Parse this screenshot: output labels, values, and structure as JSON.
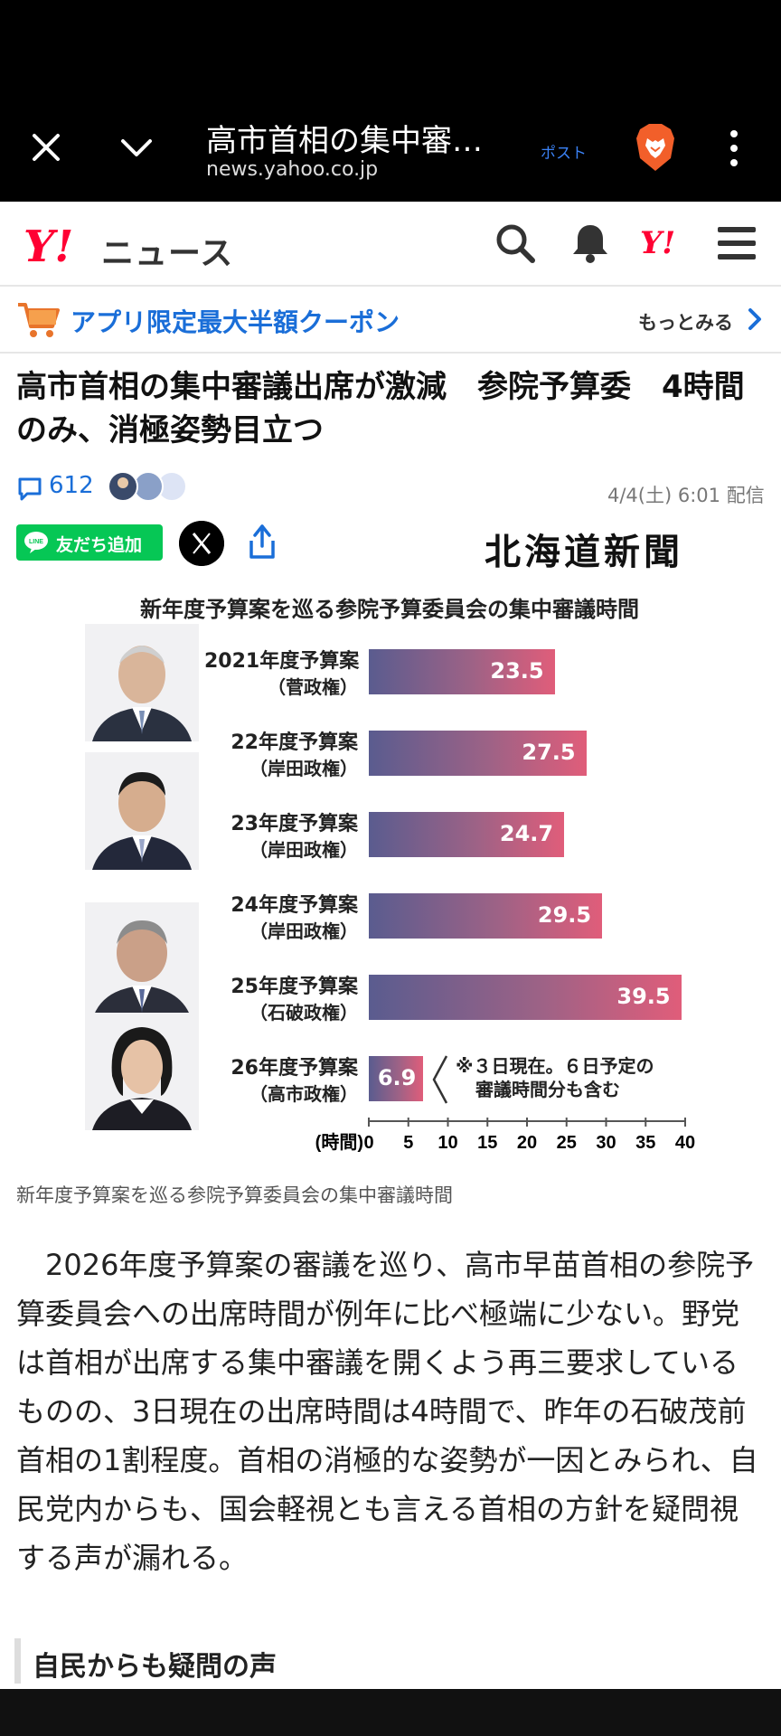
{
  "browser": {
    "tab_title": "高市首相の集中審…",
    "url": "news.yahoo.co.jp",
    "post_label": "ポスト"
  },
  "site": {
    "logo": "Y!",
    "section": "ニュース",
    "logo_small": "Y!",
    "brand_color": "#ff0033"
  },
  "promo": {
    "text": "アプリ限定最大半額クーポン",
    "more": "もっとみる"
  },
  "article": {
    "headline": "高市首相の集中審議出席が激減　参院予算委　4時間のみ、消極姿勢目立つ",
    "comment_count": "612",
    "published": "4/4(土) 6:01 配信",
    "line_button": "友だち追加",
    "line_badge": "LINE",
    "publisher": "北海道新聞",
    "caption": "新年度予算案を巡る参院予算委員会の集中審議時間",
    "body": "2026年度予算案の審議を巡り、高市早苗首相の参院予算委員会への出席時間が例年に比べ極端に少ない。野党は首相が出席する集中審議を開くよう再三要求しているものの、3日現在の出席時間は4時間で、昨年の石破茂前首相の1割程度。首相の消極的な姿勢が一因とみられ、自民党内からも、国会軽視とも言える首相の方針を疑問視する声が漏れる。",
    "subheading": "自民からも疑問の声"
  },
  "chart_data": {
    "type": "bar",
    "orientation": "horizontal",
    "title": "新年度予算案を巡る参院予算委員会の集中審議時間",
    "categories": [
      "2021年度予算案",
      "22年度予算案",
      "23年度予算案",
      "24年度予算案",
      "25年度予算案",
      "26年度予算案"
    ],
    "subcategories": [
      "（菅政権）",
      "（岸田政権）",
      "（岸田政権）",
      "（岸田政権）",
      "（石破政権）",
      "（高市政権）"
    ],
    "values": [
      23.5,
      27.5,
      24.7,
      29.5,
      39.5,
      6.9
    ],
    "value_labels": [
      "23.5",
      "27.5",
      "24.7",
      "29.5",
      "39.5",
      "6.9"
    ],
    "xlabel": "(時間)",
    "xlim": [
      0,
      40
    ],
    "xticks": [
      "0",
      "5",
      "10",
      "15",
      "20",
      "25",
      "30",
      "35",
      "40"
    ],
    "annotation_lines": [
      "※３日現在。６日予定の",
      "審議時間分も含む"
    ],
    "bar_gradient": [
      "#5a5c8f",
      "#e05d7a"
    ]
  }
}
